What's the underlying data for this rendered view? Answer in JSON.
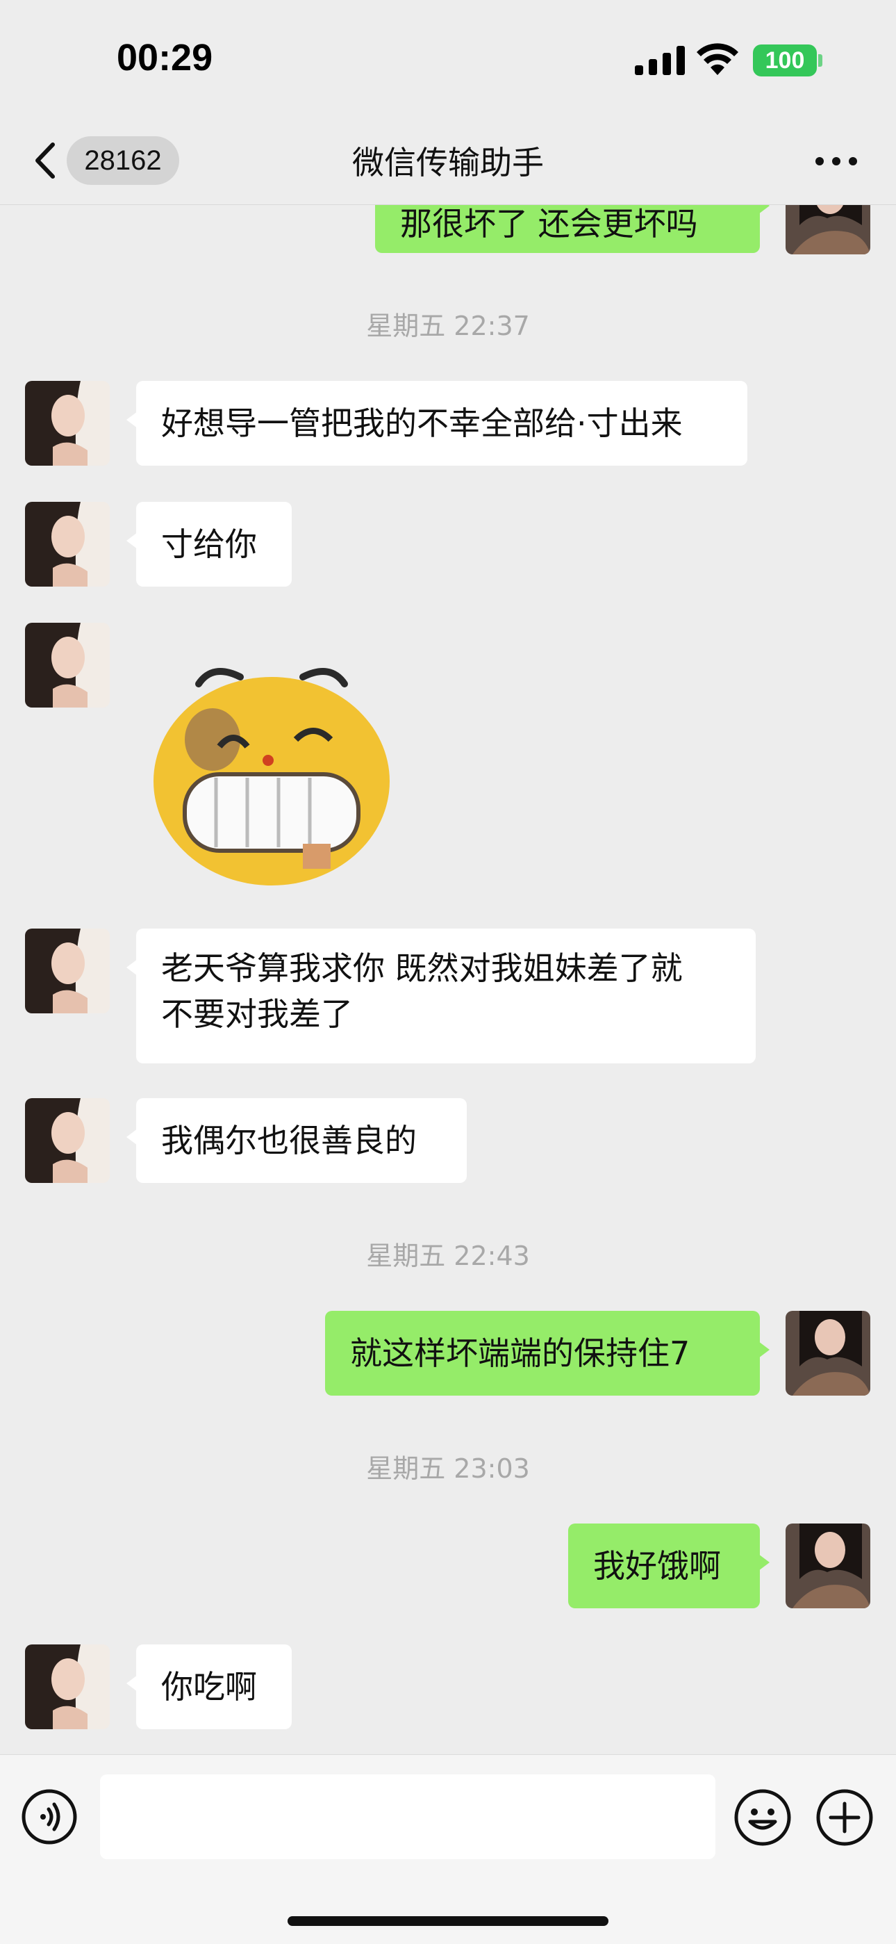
{
  "status": {
    "time": "00:29",
    "battery": "100"
  },
  "nav": {
    "back_count": "28162",
    "title": "微信传输助手"
  },
  "messages": {
    "m0": {
      "text": "那很坏了 还会更坏吗"
    },
    "t1": {
      "text": "星期五 22:37"
    },
    "m1": {
      "text": "好想导一管把我的不幸全部给·寸出来"
    },
    "m2": {
      "text": "寸给你"
    },
    "m4": {
      "line1": "老天爷算我求你 既然对我姐妹差了就",
      "line2": "不要对我差了"
    },
    "m5": {
      "text": "我偶尔也很善良的"
    },
    "t2": {
      "text": "星期五 22:43"
    },
    "m6": {
      "text": "就这样坏端端的保持住7"
    },
    "t3": {
      "text": "星期五 23:03"
    },
    "m7": {
      "text": "我好饿啊"
    },
    "m8": {
      "text": "你吃啊"
    }
  },
  "input": {
    "placeholder": ""
  },
  "colors": {
    "background": "#ededed",
    "incoming_bubble": "#ffffff",
    "outgoing_bubble": "#95ec69",
    "battery": "#34c759"
  }
}
